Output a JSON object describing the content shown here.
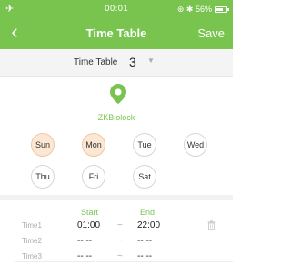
{
  "status_bar": {
    "airplane_icon": "airplane-icon",
    "time": "00:01",
    "indicators": "⊛ ✱ 56%"
  },
  "nav": {
    "back_icon": "chevron-left-icon",
    "back_glyph": "‹",
    "title": "Time Table",
    "save_label": "Save"
  },
  "selector": {
    "label": "Time Table",
    "value": "3",
    "arrow_icon": "dropdown-triangle-icon",
    "arrow_glyph": "▼"
  },
  "lock": {
    "icon": "location-pin-icon",
    "name": "ZKBiolock"
  },
  "days": [
    {
      "label": "Sun",
      "selected": true
    },
    {
      "label": "Mon",
      "selected": true
    },
    {
      "label": "Tue",
      "selected": false
    },
    {
      "label": "Wed",
      "selected": false
    },
    {
      "label": "Thu",
      "selected": false
    },
    {
      "label": "Fri",
      "selected": false
    },
    {
      "label": "Sat",
      "selected": false
    }
  ],
  "columns": {
    "start": "Start",
    "end": "End"
  },
  "time_slots": [
    {
      "name": "Time1",
      "start": "01:00",
      "separator": "~",
      "end": "22:00"
    },
    {
      "name": "Time2",
      "start": "-- --",
      "separator": "~",
      "end": "-- --"
    },
    {
      "name": "Time3",
      "start": "-- --",
      "separator": "~",
      "end": "-- --"
    }
  ],
  "colors": {
    "brand_green": "#79c34f",
    "selected_day_fill": "#fbe7d4"
  }
}
